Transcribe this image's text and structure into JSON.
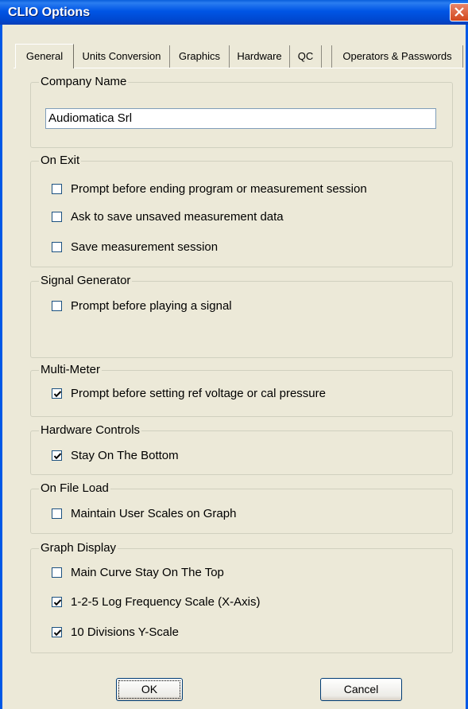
{
  "window": {
    "title": "CLIO Options"
  },
  "tabs": [
    {
      "label": "General"
    },
    {
      "label": "Units Conversion"
    },
    {
      "label": "Graphics"
    },
    {
      "label": "Hardware"
    },
    {
      "label": "QC"
    },
    {
      "label": "Operators & Passwords"
    }
  ],
  "company": {
    "label": "Company Name",
    "value": "Audiomatica Srl"
  },
  "on_exit": {
    "label": "On Exit",
    "options": [
      {
        "label": "Prompt before ending program or measurement session",
        "checked": false
      },
      {
        "label": "Ask to save unsaved measurement data",
        "checked": false
      },
      {
        "label": "Save measurement session",
        "checked": false
      }
    ]
  },
  "signal_generator": {
    "label": "Signal Generator",
    "options": [
      {
        "label": "Prompt before playing a signal",
        "checked": false
      }
    ]
  },
  "multi_meter": {
    "label": "Multi-Meter",
    "options": [
      {
        "label": "Prompt before setting ref voltage or cal pressure",
        "checked": true
      }
    ]
  },
  "hardware_controls": {
    "label": "Hardware Controls",
    "options": [
      {
        "label": "Stay On The Bottom",
        "checked": true
      }
    ]
  },
  "on_file_load": {
    "label": "On File Load",
    "options": [
      {
        "label": "Maintain User Scales on Graph",
        "checked": false
      }
    ]
  },
  "graph_display": {
    "label": "Graph Display",
    "options": [
      {
        "label": "Main Curve Stay On The Top",
        "checked": false
      },
      {
        "label": "1-2-5 Log Frequency Scale (X-Axis)",
        "checked": true
      },
      {
        "label": "10 Divisions Y-Scale",
        "checked": true
      }
    ]
  },
  "buttons": {
    "ok": "OK",
    "cancel": "Cancel"
  }
}
